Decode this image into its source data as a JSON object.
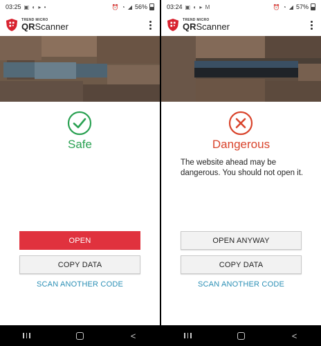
{
  "screens": [
    {
      "status": {
        "time": "03:25",
        "battery": "56%"
      },
      "brand": {
        "small": "TREND MICRO",
        "qr": "QR",
        "scanner": "Scanner"
      },
      "result": {
        "label": "Safe",
        "icon": "check-circle-icon",
        "color": "#2aa152"
      },
      "buttons": {
        "open": "OPEN",
        "copy": "COPY DATA",
        "scan_another": "SCAN ANOTHER CODE"
      }
    },
    {
      "status": {
        "time": "03:24",
        "battery": "57%"
      },
      "brand": {
        "small": "TREND MICRO",
        "qr": "QR",
        "scanner": "Scanner"
      },
      "result": {
        "label": "Dangerous",
        "icon": "x-circle-icon",
        "color": "#d9442c",
        "message": "The website ahead may be dangerous. You should not open it."
      },
      "buttons": {
        "open": "OPEN ANYWAY",
        "copy": "COPY DATA",
        "scan_another": "SCAN ANOTHER CODE"
      }
    }
  ],
  "colors": {
    "open_button": "#e0323e",
    "link": "#2a8fb5",
    "brand_red": "#d8222f"
  }
}
